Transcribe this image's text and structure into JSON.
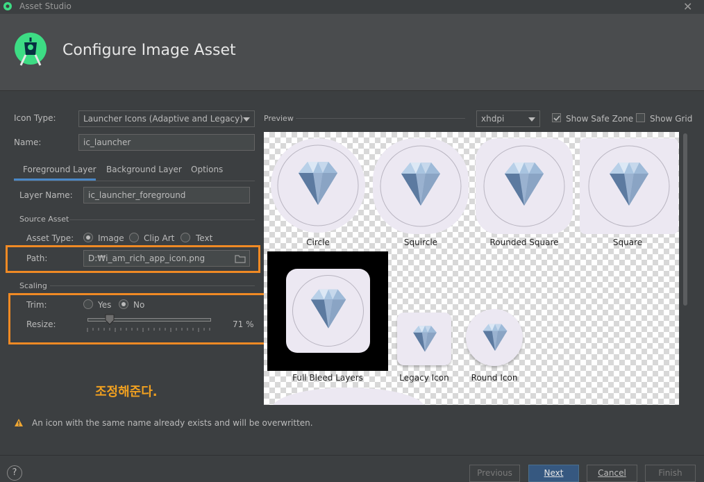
{
  "window": {
    "title": "Asset Studio",
    "close_glyph": "✕"
  },
  "header": {
    "title": "Configure Image Asset"
  },
  "form": {
    "icon_type_label": "Icon Type:",
    "icon_type_value": "Launcher Icons (Adaptive and Legacy)",
    "name_label": "Name:",
    "name_value": "ic_launcher",
    "tabs": [
      "Foreground Layer",
      "Background Layer",
      "Options"
    ],
    "layer_name_label": "Layer Name:",
    "layer_name_value": "ic_launcher_foreground",
    "source_asset_label": "Source Asset",
    "asset_type_label": "Asset Type:",
    "asset_type_options": [
      "Image",
      "Clip Art",
      "Text"
    ],
    "asset_type_selected": "Image",
    "path_label": "Path:",
    "path_value": "D:₩i_am_rich_app_icon.png",
    "scaling_label": "Scaling",
    "trim_label": "Trim:",
    "trim_options": [
      "Yes",
      "No"
    ],
    "trim_selected": "No",
    "resize_label": "Resize:",
    "resize_value_text": "71 %",
    "resize_percent": 71
  },
  "annotation": {
    "text": "조정해준다."
  },
  "preview": {
    "label": "Preview",
    "density_value": "xhdpi",
    "show_safe_zone_label": "Show Safe Zone",
    "show_safe_zone_checked": true,
    "show_grid_label": "Show Grid",
    "show_grid_checked": false,
    "items": [
      "Circle",
      "Squircle",
      "Rounded Square",
      "Square",
      "Full Bleed Layers",
      "Legacy Icon",
      "Round Icon"
    ]
  },
  "warning": {
    "text": "An icon with the same name already exists and will be overwritten."
  },
  "footer": {
    "help_glyph": "?",
    "previous_label": "Previous",
    "next_label": "Next",
    "cancel_label": "Cancel",
    "finish_label": "Finish"
  },
  "colors": {
    "accent_orange": "#f08a24",
    "primary_button": "#365880",
    "android_green": "#3ddc84"
  }
}
